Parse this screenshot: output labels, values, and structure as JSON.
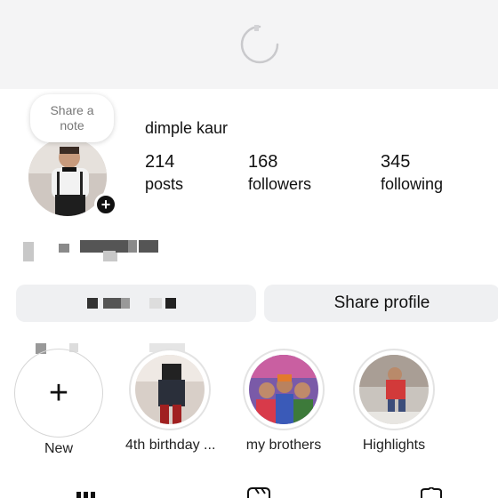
{
  "profile": {
    "name": "dimple kaur",
    "note_line1": "Share a",
    "note_line2": "note",
    "stats": [
      {
        "number": "214",
        "label": "posts"
      },
      {
        "number": "168",
        "label": "followers"
      },
      {
        "number": "345",
        "label": "following"
      }
    ]
  },
  "actions": {
    "share_profile": "Share profile"
  },
  "highlights": [
    {
      "label": "New"
    },
    {
      "label": "4th birthday ..."
    },
    {
      "label": "my brothers"
    },
    {
      "label": "Highlights"
    }
  ],
  "icons": {
    "loading": "spinner-icon",
    "add_note": "plus-icon",
    "new_highlight": "plus-icon",
    "grid_tab": "grid-icon",
    "reels_tab": "reels-icon",
    "tagged_tab": "tagged-icon"
  }
}
